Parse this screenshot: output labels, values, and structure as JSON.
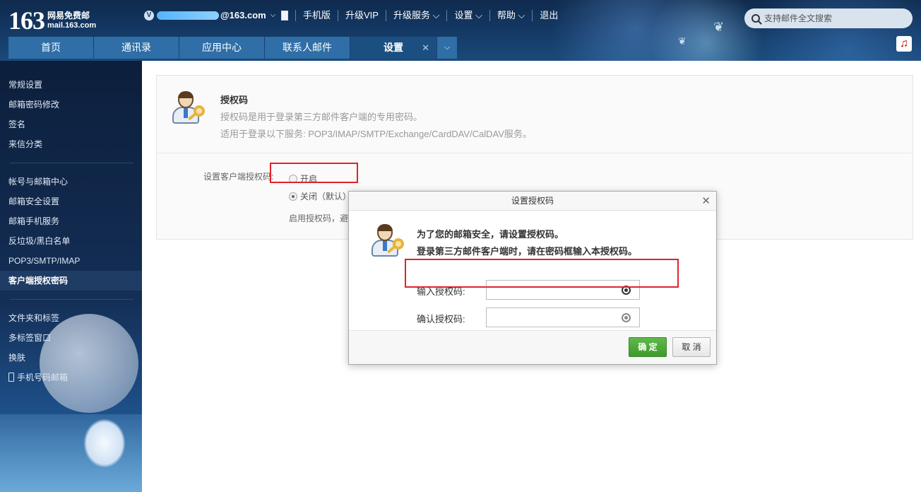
{
  "header": {
    "logo_number": "163",
    "logo_cn": "网易免费邮",
    "logo_en": "mail.163.com",
    "user_badge": "V",
    "user_domain": "@163.com",
    "nav": [
      "手机版",
      "升级VIP",
      "升级服务 ⌵",
      "设置 ⌵",
      "帮助 ⌵",
      "退出"
    ],
    "search_placeholder": "支持邮件全文搜索"
  },
  "tabs": [
    {
      "label": "首页"
    },
    {
      "label": "通讯录"
    },
    {
      "label": "应用中心"
    },
    {
      "label": "联系人邮件"
    },
    {
      "label": "设置",
      "active": true
    }
  ],
  "sidebar": {
    "groups": [
      {
        "items": [
          "常规设置",
          "邮箱密码修改",
          "签名",
          "来信分类"
        ]
      },
      {
        "items": [
          "帐号与邮箱中心",
          "邮箱安全设置",
          "邮箱手机服务",
          "反垃圾/黑白名单",
          "POP3/SMTP/IMAP",
          "客户端授权密码"
        ]
      },
      {
        "items": [
          "文件夹和标签",
          "多标签窗口",
          "换肤",
          "手机号码邮箱"
        ]
      }
    ],
    "active_item": "客户端授权密码"
  },
  "panel": {
    "title": "授权码",
    "desc1": "授权码是用于登录第三方邮件客户端的专用密码。",
    "desc2": "适用于登录以下服务: POP3/IMAP/SMTP/Exchange/CardDAV/CalDAV服务。",
    "option_label": "设置客户端授权码:",
    "on_label": "开启",
    "off_label": "关闭（默认）",
    "hint": "启用授权码，避"
  },
  "dialog": {
    "title": "设置授权码",
    "line1": "为了您的邮箱安全，请设置授权码。",
    "line2": "登录第三方邮件客户端时，请在密码框输入本授权码。",
    "field1_label": "输入授权码:",
    "field2_label": "确认授权码:",
    "ok_label": "确 定",
    "cancel_label": "取 消"
  },
  "icons": [
    "search-icon",
    "close-icon",
    "chevron-down-icon",
    "music-icon",
    "eye-icon",
    "user-key-icon",
    "phone-icon"
  ],
  "colors": {
    "accent_red": "#e0232b",
    "ok_green": "#4caf3a",
    "tab_blue": "#2f6ea6"
  }
}
